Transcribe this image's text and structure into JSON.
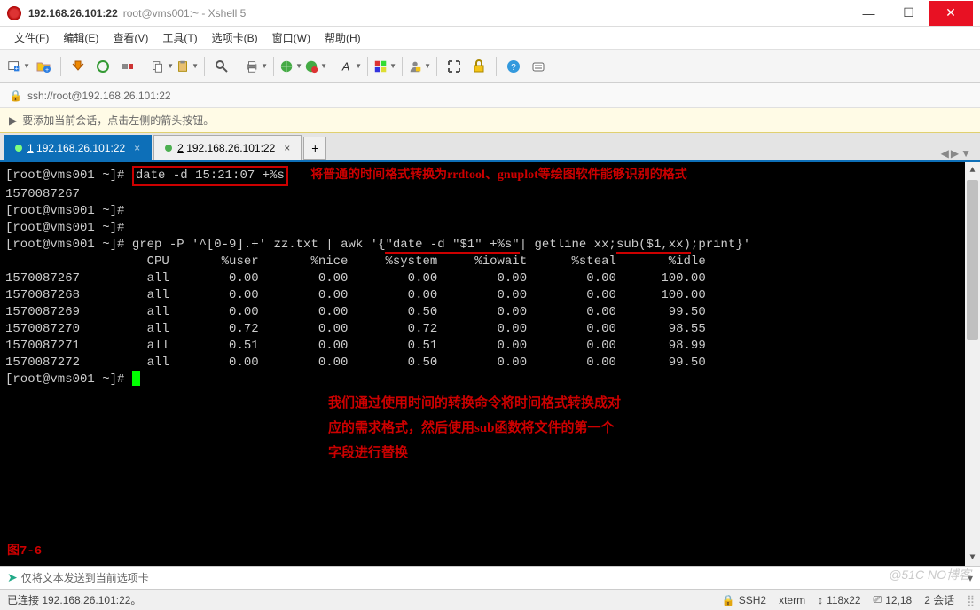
{
  "titlebar": {
    "host": "192.168.26.101:22",
    "rest": "root@vms001:~ - Xshell 5"
  },
  "menu": [
    "文件(F)",
    "编辑(E)",
    "查看(V)",
    "工具(T)",
    "选项卡(B)",
    "窗口(W)",
    "帮助(H)"
  ],
  "toolbar_icons": [
    "new-session-icon",
    "folder-add-icon",
    "sep",
    "transfer-icon",
    "reconnect-icon",
    "disconnect-icon",
    "sep",
    "copy-icon",
    "paste-icon",
    "sep",
    "search-icon",
    "sep",
    "printer-new-icon",
    "sep",
    "globe-green-icon",
    "globe-red-icon",
    "sep",
    "font-icon",
    "sep",
    "palette-icon",
    "sep",
    "user-lock-icon",
    "sep",
    "fullscreen-icon",
    "lock-icon",
    "sep",
    "help-icon",
    "about-icon"
  ],
  "addressbar": {
    "url": "ssh://root@192.168.26.101:22"
  },
  "infobar": {
    "text": "要添加当前会话，点击左侧的箭头按钮。"
  },
  "tabs": [
    {
      "index": "1",
      "label": "192.168.26.101:22",
      "active": true
    },
    {
      "index": "2",
      "label": "192.168.26.101:22",
      "active": false
    }
  ],
  "terminal": {
    "prompt": "[root@vms001 ~]#",
    "cmd1": "date -d 15:21:07 +%s",
    "note1": "将普通的时间格式转换为rrdtool、gnuplot等绘图软件能够识别的格式",
    "out1": "1570087267",
    "cmd2_pre": "grep -P '^[0-9].+' zz.txt | awk '{",
    "cmd2_u1": "\"date -d \"$1\" +%s\"",
    "cmd2_mid": "| getline xx;",
    "cmd2_u2": "sub($1,xx)",
    "cmd2_post": ";print}'",
    "header": "                   CPU       %user       %nice     %system     %iowait      %steal       %idle",
    "rows": [
      "1570087267         all        0.00        0.00        0.00        0.00        0.00      100.00",
      "1570087268         all        0.00        0.00        0.00        0.00        0.00      100.00",
      "1570087269         all        0.00        0.00        0.50        0.00        0.00       99.50",
      "1570087270         all        0.72        0.00        0.72        0.00        0.00       98.55",
      "1570087271         all        0.51        0.00        0.51        0.00        0.00       98.99",
      "1570087272         all        0.00        0.00        0.50        0.00        0.00       99.50"
    ],
    "annotation2_l1": "我们通过使用时间的转换命令将时间格式转换成对",
    "annotation2_l2": "应的需求格式，然后使用sub函数将文件的第一个",
    "annotation2_l3": "字段进行替换",
    "fig_label": "图7-6"
  },
  "sendrow": {
    "text": "仅将文本发送到当前选项卡"
  },
  "statusbar": {
    "conn": "已连接 192.168.26.101:22。",
    "proto": "SSH2",
    "term": "xterm",
    "size": "118x22",
    "pos": "12,18",
    "sessions": "2 会话"
  },
  "watermark": "@51C NO博客"
}
